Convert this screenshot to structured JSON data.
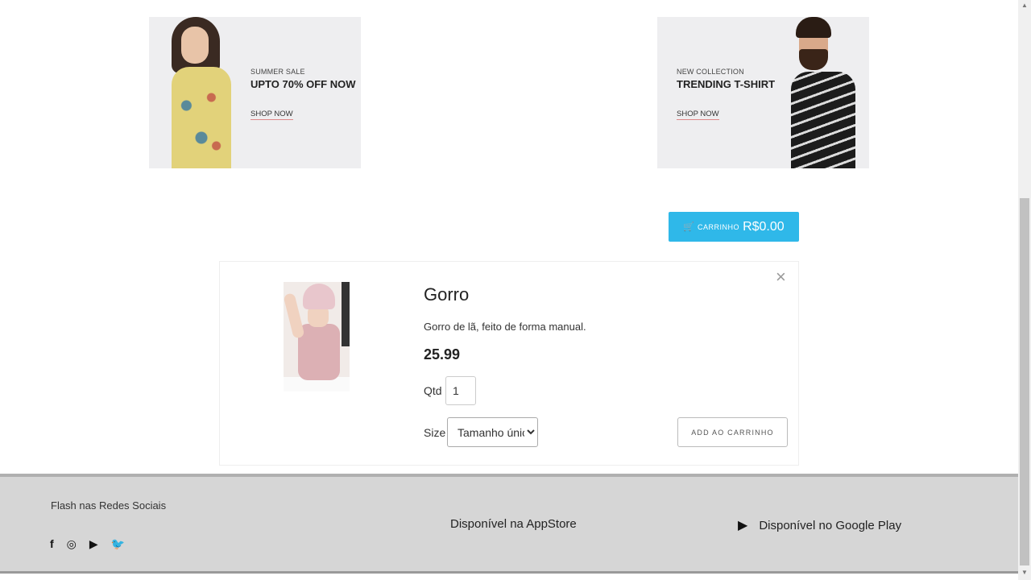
{
  "banners": {
    "left": {
      "kicker": "SUMMER SALE",
      "headline": "UPTO 70% OFF NOW",
      "cta": "SHOP NOW"
    },
    "right": {
      "kicker": "NEW COLLECTION",
      "headline": "TRENDING T-SHIRT",
      "cta": "SHOP NOW"
    }
  },
  "cart": {
    "icon": "🛒",
    "label": "CARRINHO",
    "total": "R$0.00"
  },
  "product": {
    "close": "×",
    "name": "Gorro",
    "description": "Gorro de lã, feito de forma manual.",
    "price": "25.99",
    "qty_label": "Qtd",
    "qty_value": "1",
    "size_label": "Size",
    "size_selected": "Tamanho único",
    "add_button": "ADD AO CARRINHO"
  },
  "footer": {
    "social_title": "Flash nas Redes Sociais",
    "social_icons": [
      "facebook-icon",
      "instagram-icon",
      "youtube-icon",
      "twitter-icon"
    ],
    "appstore": "Disponível na AppStore",
    "googleplay": "Disponível no Google Play"
  },
  "colors": {
    "accent": "#2fb8e9",
    "footer_bg": "#d6d6d6"
  }
}
